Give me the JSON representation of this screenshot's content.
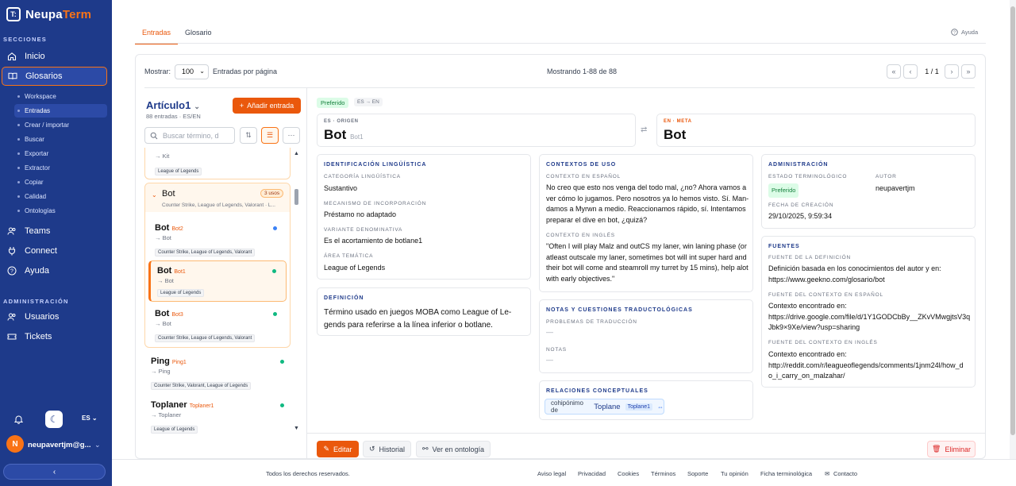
{
  "app": {
    "logo_text_1": "Neupa",
    "logo_text_2": "Term",
    "logo_mark": "T:"
  },
  "sidebar": {
    "section_label": "SECCIONES",
    "items": [
      {
        "label": "Inicio",
        "icon": "home-icon"
      },
      {
        "label": "Glosarios",
        "icon": "book-icon"
      }
    ],
    "subitems": [
      "Workspace",
      "Entradas",
      "Crear / importar",
      "Buscar",
      "Exportar",
      "Extractor",
      "Copiar",
      "Calidad",
      "Ontologías"
    ],
    "items2": [
      {
        "label": "Teams",
        "icon": "users-icon"
      },
      {
        "label": "Connect",
        "icon": "plug-icon"
      },
      {
        "label": "Ayuda",
        "icon": "help-icon"
      }
    ],
    "admin_label": "ADMINISTRACIÓN",
    "admin_items": [
      {
        "label": "Usuarios",
        "icon": "users-icon"
      },
      {
        "label": "Tickets",
        "icon": "ticket-icon"
      }
    ],
    "lang": "ES",
    "user_initial": "N",
    "user_name": "neupavertjm@g..."
  },
  "tabs": [
    "Entradas",
    "Glosario"
  ],
  "help_label": "Ayuda",
  "toolbar": {
    "show_label": "Mostrar:",
    "page_size": "100",
    "per_page_label": "Entradas por página",
    "showing": "Mostrando 1-88 de 88",
    "page": "1 / 1"
  },
  "glossary": {
    "title": "Artículo1",
    "subtitle": "88 entradas · ES/EN",
    "add_label": "Añadir entrada",
    "search_placeholder": "Buscar término, d"
  },
  "list": {
    "first": {
      "arrow": "→ Kit",
      "tag": "League of Legends"
    },
    "group": {
      "title": "Bot",
      "badge": "3 usos",
      "domains": "Counter Strike, League of Legends, Valorant · L..."
    },
    "entries": [
      {
        "term": "Bot",
        "sub": "Bot2",
        "arrow": "→ Bot",
        "tag": "Counter Strike, League of Legends, Valorant",
        "dot": "#3b82f6"
      },
      {
        "term": "Bot",
        "sub": "Bot1",
        "arrow": "→ Bot",
        "tag": "League of Legends",
        "dot": "#10b981"
      },
      {
        "term": "Bot",
        "sub": "Bot3",
        "arrow": "→ Bot",
        "tag": "Counter Strike, League of Legends, Valorant",
        "dot": "#10b981"
      }
    ],
    "others": [
      {
        "term": "Ping",
        "sub": "Ping1",
        "arrow": "→ Ping",
        "tag": "Counter Strike, Valorant, League of Legends"
      },
      {
        "term": "Toplaner",
        "sub": "Toplaner1",
        "arrow": "→ Toplaner",
        "tag": "League of Legends"
      }
    ]
  },
  "detail": {
    "status_badge": "Preferido",
    "direction": "ES → EN",
    "source_label": "ES · ORIGEN",
    "source_term": "Bot",
    "source_sub": "Bot1",
    "target_label": "EN · META",
    "target_term": "Bot",
    "ident": {
      "heading": "IDENTIFICACIÓN LINGÜÍSTICA",
      "cat_label": "CATEGORÍA LINGÜÍSTICA",
      "cat": "Sustantivo",
      "mech_label": "MECANISMO DE INCORPORACIÓN",
      "mech": "Préstamo no adaptado",
      "var_label": "VARIANTE DENOMINATIVA",
      "var": "Es el acortamiento de botlane1",
      "area_label": "ÁREA TEMÁTICA",
      "area": "League of Legends"
    },
    "def": {
      "heading": "DEFINICIÓN",
      "text1": "Término usado en juegos MOBA como League of Le-",
      "text2": "gends para referirse a la línea inferior o botlane."
    },
    "ctx": {
      "heading": "CONTEXTOS DE USO",
      "es_label": "CONTEXTO EN ESPAÑOL",
      "es": [
        "No creo que esto nos venga del todo mal, ¿no? Ahora vamos a",
        "ver cómo lo jugamos. Pero nosotros ya lo hemos visto. Sí. Man-",
        "damos a Myrwn a medio. Reaccionamos rápido, sí. Intentamos",
        "preparar el dive en bot, ¿quizá?"
      ],
      "en_label": "CONTEXTO EN INGLÉS",
      "en": [
        "\"Often I will play Malz and outCS my laner, win laning phase (or",
        "atleast outscale my laner, sometimes bot will int super hard and",
        "their bot will come and steamroll my turret by 15 mins), help alot",
        "with early objectives.\""
      ]
    },
    "notes": {
      "heading": "NOTAS Y CUESTIONES TRADUCTOLÓGICAS",
      "prob_label": "PROBLEMAS DE TRADUCCIÓN",
      "prob": "—",
      "notes_label": "NOTAS",
      "notes": "—"
    },
    "rel": {
      "heading": "RELACIONES CONCEPTUALES",
      "type": "cohipónimo de",
      "term": "Toplane",
      "sub": "Toplane1"
    },
    "admin": {
      "heading": "ADMINISTRACIÓN",
      "status_label": "ESTADO TERMINOLÓGICO",
      "status": "Preferido",
      "author_label": "AUTOR",
      "author": "neupavertjm",
      "date_label": "FECHA DE CREACIÓN",
      "date": "29/10/2025, 9:59:34"
    },
    "sources": {
      "heading": "FUENTES",
      "def_label": "FUENTE DE LA DEFINICIÓN",
      "def": [
        "Definición basada en los conocimientos del autor y en:",
        "https://www.geekno.com/glosario/bot"
      ],
      "es_label": "FUENTE DEL CONTEXTO EN ESPAÑOL",
      "es": [
        "Contexto encontrado en:",
        "https://drive.google.com/file/d/1Y1GODCbBy__ZKvVMwgjtsV3q",
        "Jbk9×9Xe/view?usp=sharing"
      ],
      "en_label": "FUENTE DEL CONTEXTO EN INGLÉS",
      "en": [
        "Contexto encontrado en:",
        "http://reddit.com/r/leagueoflegends/comments/1jnm24l/how_d",
        "o_i_carry_on_malzahar/"
      ]
    },
    "actions": {
      "edit": "Editar",
      "history": "Historial",
      "ontology": "Ver en ontología",
      "delete": "Eliminar"
    }
  },
  "footer": {
    "copyright": "Todos los derechos reservados.",
    "links": [
      "Aviso legal",
      "Privacidad",
      "Cookies",
      "Términos",
      "Soporte",
      "Tu opinión",
      "Ficha terminológica",
      "Contacto"
    ]
  },
  "colors": {
    "sidebar": "#1e3a8a",
    "accent": "#ea580c",
    "preferred": "#15803d"
  }
}
